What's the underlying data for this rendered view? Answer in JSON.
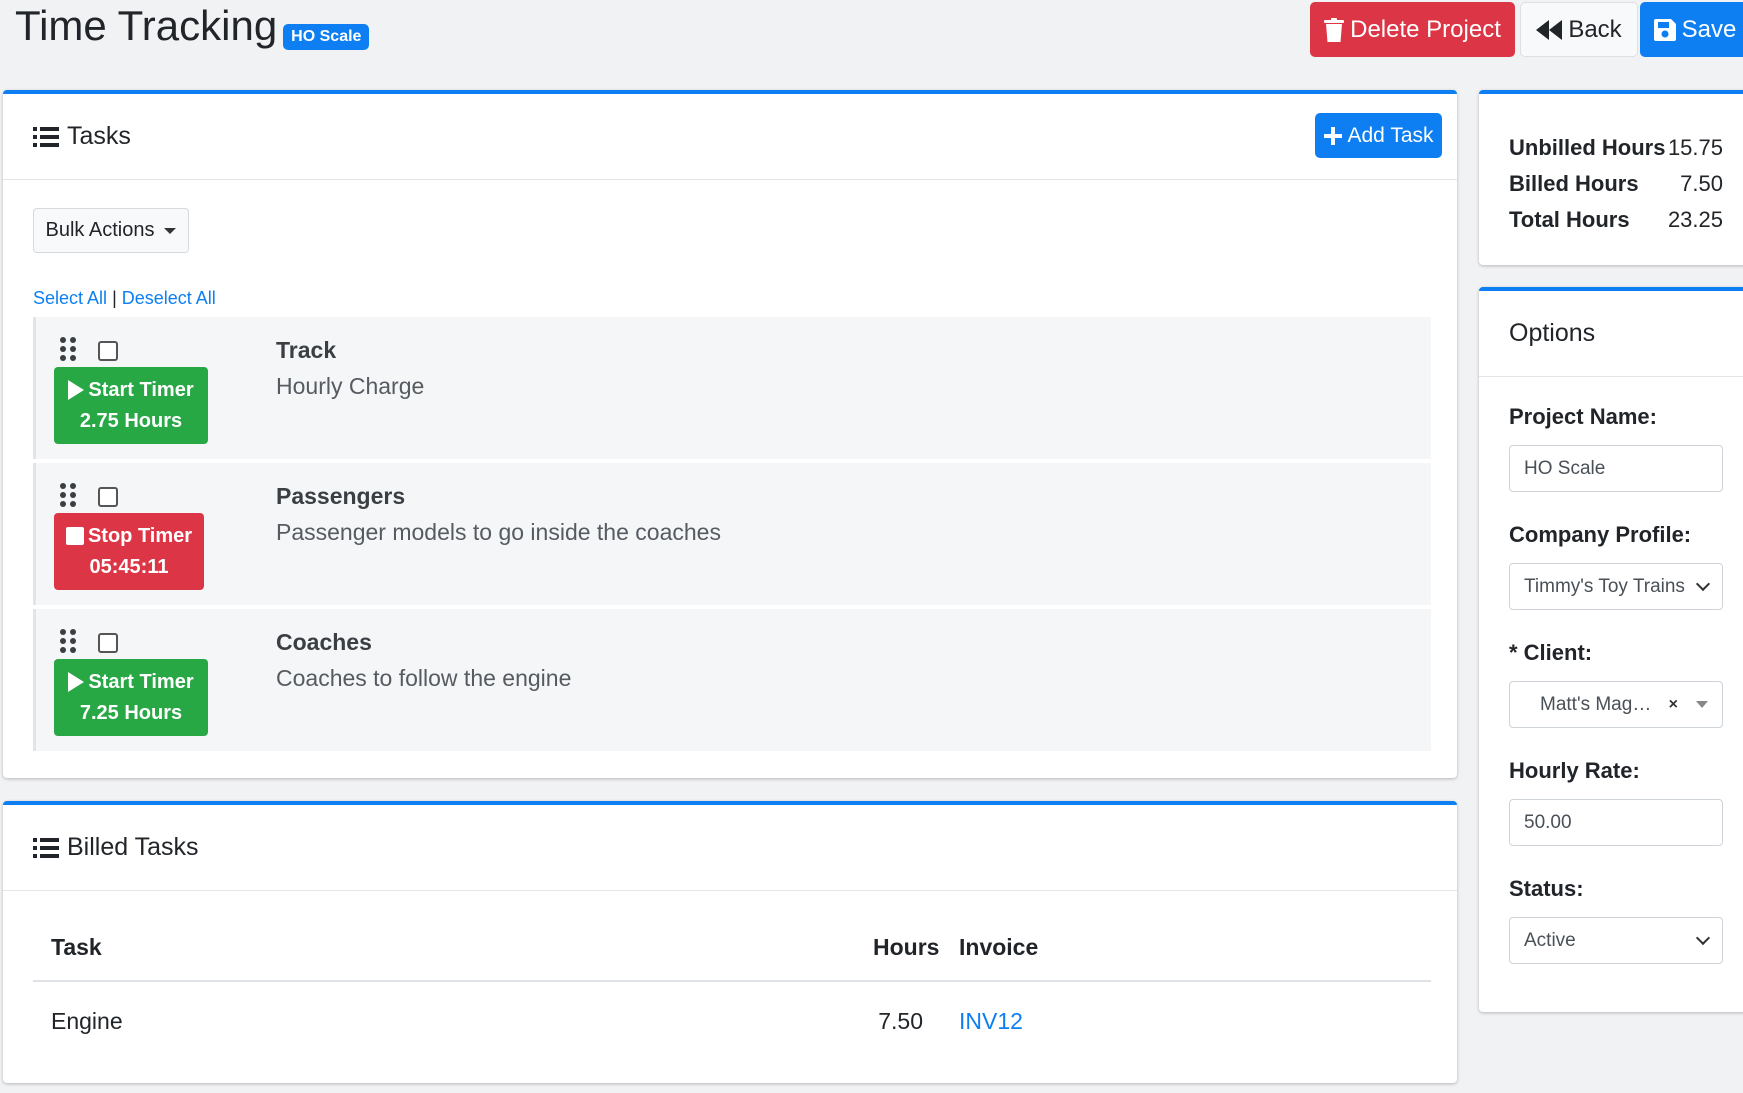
{
  "header": {
    "title": "Time Tracking",
    "badge": "HO Scale",
    "delete_label": "Delete Project",
    "back_label": "Back",
    "save_label": "Save"
  },
  "tasks_card": {
    "title": "Tasks",
    "add_task_label": "Add Task",
    "bulk_actions_label": "Bulk Actions",
    "select_all": "Select All",
    "separator": "|",
    "deselect_all": "Deselect All",
    "items": [
      {
        "name": "Track",
        "description": "Hourly Charge",
        "timer_label": "Start Timer",
        "timer_value": "2.75 Hours"
      },
      {
        "name": "Passengers",
        "description": "Passenger models to go inside the coaches",
        "timer_label": "Stop Timer",
        "timer_value": "05:45:11"
      },
      {
        "name": "Coaches",
        "description": "Coaches to follow the engine",
        "timer_label": "Start Timer",
        "timer_value": "7.25 Hours"
      }
    ]
  },
  "billed_card": {
    "title": "Billed Tasks",
    "columns": {
      "task": "Task",
      "hours": "Hours",
      "invoice": "Invoice"
    },
    "rows": [
      {
        "task": "Engine",
        "hours": "7.50",
        "invoice": "INV12"
      }
    ]
  },
  "summary": {
    "unbilled_label": "Unbilled Hours",
    "unbilled_value": "15.75",
    "billed_label": "Billed Hours",
    "billed_value": "7.50",
    "total_label": "Total Hours",
    "total_value": "23.25"
  },
  "options": {
    "title": "Options",
    "project_name_label": "Project Name:",
    "project_name_value": "HO Scale",
    "company_profile_label": "Company Profile:",
    "company_profile_value": "Timmy's Toy Trains",
    "client_label": "* Client:",
    "client_value": "Matt's Mag…",
    "client_clear": "×",
    "hourly_rate_label": "Hourly Rate:",
    "hourly_rate_value": "50.00",
    "status_label": "Status:",
    "status_value": "Active"
  },
  "colors": {
    "primary": "#0d7ff2",
    "danger": "#dc3545",
    "success": "#28a745",
    "background": "#f1f2f4"
  }
}
